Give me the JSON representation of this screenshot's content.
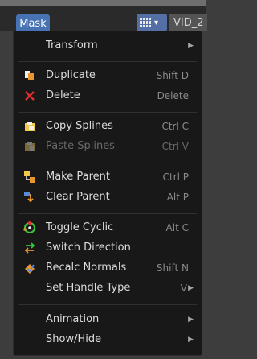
{
  "header": {
    "mask_label": "Mask",
    "clip_name": "VID_2",
    "mode_icon": "clip-editor-icon"
  },
  "menu": {
    "items": [
      {
        "label": "Transform",
        "shortcut": "",
        "submenu": true,
        "icon": ""
      },
      {
        "label": "Duplicate",
        "shortcut": "Shift D",
        "submenu": false,
        "icon": "duplicate-icon"
      },
      {
        "label": "Delete",
        "shortcut": "Delete",
        "submenu": false,
        "icon": "delete-x-icon"
      },
      {
        "label": "Copy Splines",
        "shortcut": "Ctrl C",
        "submenu": false,
        "icon": "copy-icon"
      },
      {
        "label": "Paste Splines",
        "shortcut": "Ctrl V",
        "submenu": false,
        "icon": "paste-icon",
        "disabled": true
      },
      {
        "label": "Make Parent",
        "shortcut": "Ctrl P",
        "submenu": false,
        "icon": "make-parent-icon"
      },
      {
        "label": "Clear Parent",
        "shortcut": "Alt P",
        "submenu": false,
        "icon": "clear-parent-icon"
      },
      {
        "label": "Toggle Cyclic",
        "shortcut": "Alt C",
        "submenu": false,
        "icon": "toggle-cyclic-icon"
      },
      {
        "label": "Switch Direction",
        "shortcut": "",
        "submenu": false,
        "icon": "switch-direction-icon"
      },
      {
        "label": "Recalc Normals",
        "shortcut": "Shift N",
        "submenu": false,
        "icon": "recalc-normals-icon"
      },
      {
        "label": "Set Handle Type",
        "shortcut": "V",
        "submenu": true,
        "icon": ""
      },
      {
        "label": "Animation",
        "shortcut": "",
        "submenu": true,
        "icon": ""
      },
      {
        "label": "Show/Hide",
        "shortcut": "",
        "submenu": true,
        "icon": ""
      }
    ]
  },
  "colors": {
    "accent": "#4772b3",
    "menu_bg": "#181818",
    "text": "#dcdcdc",
    "shortcut": "#8a8a8a"
  }
}
